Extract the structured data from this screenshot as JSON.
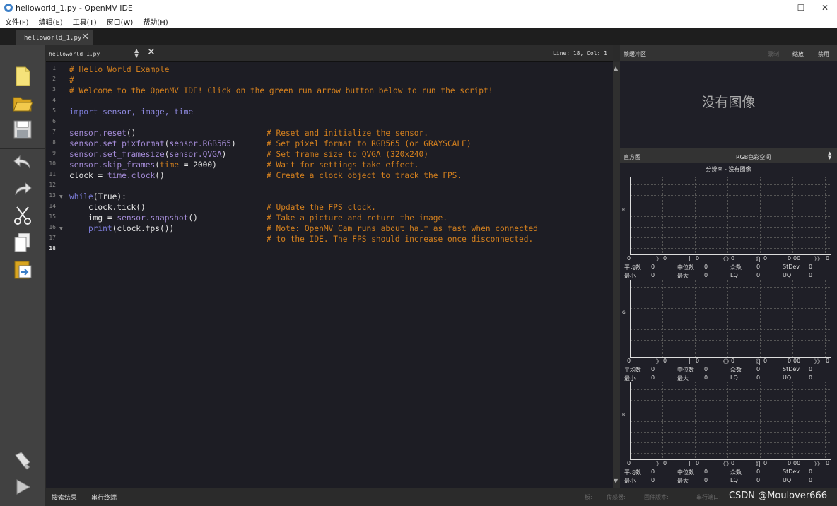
{
  "window": {
    "title": "helloworld_1.py - OpenMV IDE",
    "controls": [
      "—",
      "☐",
      "✕"
    ]
  },
  "menu": [
    "文件(F)",
    "编辑(E)",
    "工具(T)",
    "窗口(W)",
    "帮助(H)"
  ],
  "file_tab": {
    "label": "helloworld_1.py",
    "close": "✕"
  },
  "editor": {
    "file_selector": "helloworld_1.py",
    "updown": "▲\n▼",
    "close": "✕",
    "cursor_pos": "Line: 18, Col: 1",
    "line_numbers": [
      "1",
      "2",
      "3",
      "4",
      "5",
      "6",
      "7",
      "8",
      "9",
      "10",
      "11",
      "12",
      "13",
      "14",
      "15",
      "16",
      "17",
      "18"
    ]
  },
  "code": {
    "l1": "# Hello World Example",
    "l2": "#",
    "l3": "# Welcome to the OpenMV IDE! Click on the green run arrow button below to run the script!",
    "l5_a": "import",
    "l5_b": " sensor, image, time",
    "l7_a": "sensor.reset",
    "l7_b": "()",
    "l7_c": "# Reset and initialize the sensor.",
    "l8_a": "sensor.set_pixformat",
    "l8_b": "(",
    "l8_c": "sensor.RGB565",
    "l8_d": ")",
    "l8_e": "# Set pixel format to RGB565 (or GRAYSCALE)",
    "l9_a": "sensor.set_framesize",
    "l9_b": "(",
    "l9_c": "sensor.QVGA",
    "l9_d": ")",
    "l9_e": "# Set frame size to QVGA (320x240)",
    "l10_a": "sensor.skip_frames",
    "l10_b": "(",
    "l10_c": "time",
    "l10_d": " = 2000)",
    "l10_e": "# Wait for settings take effect.",
    "l11_a": "clock = ",
    "l11_b": "time.clock",
    "l11_c": "()",
    "l11_d": "# Create a clock object to track the FPS.",
    "l13_a": "while",
    "l13_b": "(True):",
    "l14_a": "    clock.tick",
    "l14_b": "()",
    "l14_c": "# Update the FPS clock.",
    "l15_a": "    img = ",
    "l15_b": "sensor.snapshot",
    "l15_c": "()",
    "l15_d": "# Take a picture and return the image.",
    "l16_a": "    print",
    "l16_b": "(clock.fps())",
    "l16_c": "# Note: OpenMV Cam runs about half as fast when connected",
    "l17_c": "# to the IDE. The FPS should increase once disconnected."
  },
  "framebuffer": {
    "label": "帧缓冲区",
    "record": "录制",
    "zoom": "缩放",
    "disable": "禁用",
    "no_image": "没有图像"
  },
  "histogram": {
    "label": "直方图",
    "colorspace": "RGB色彩空间",
    "resolution": "分辨率 - 没有图像",
    "channels": [
      "R",
      "G",
      "B"
    ],
    "ticks": [
      "0",
      "0",
      "0",
      "0",
      "0",
      "0",
      "0",
      "0",
      "0",
      "00",
      "0"
    ],
    "tick_prefix": [
      "",
      "》",
      "|",
      "《》",
      "《|",
      "》》"
    ],
    "stats_labels": {
      "mean": "平均数",
      "median": "中位数",
      "mode": "众数",
      "stdev": "StDev",
      "min": "最小",
      "max": "最大",
      "lq": "LQ",
      "uq": "UQ"
    },
    "stats_values": {
      "mean": "0",
      "median": "0",
      "mode": "0",
      "stdev": "0",
      "min": "0",
      "max": "0",
      "lq": "0",
      "uq": "0"
    }
  },
  "bottom": {
    "search_results": "搜索结果",
    "serial_terminal": "串行终端",
    "board": "板:",
    "sensor": "传感器:",
    "firmware": "固件版本:",
    "serial_port": "串行端口:"
  },
  "watermark": "CSDN @Moulover666"
}
